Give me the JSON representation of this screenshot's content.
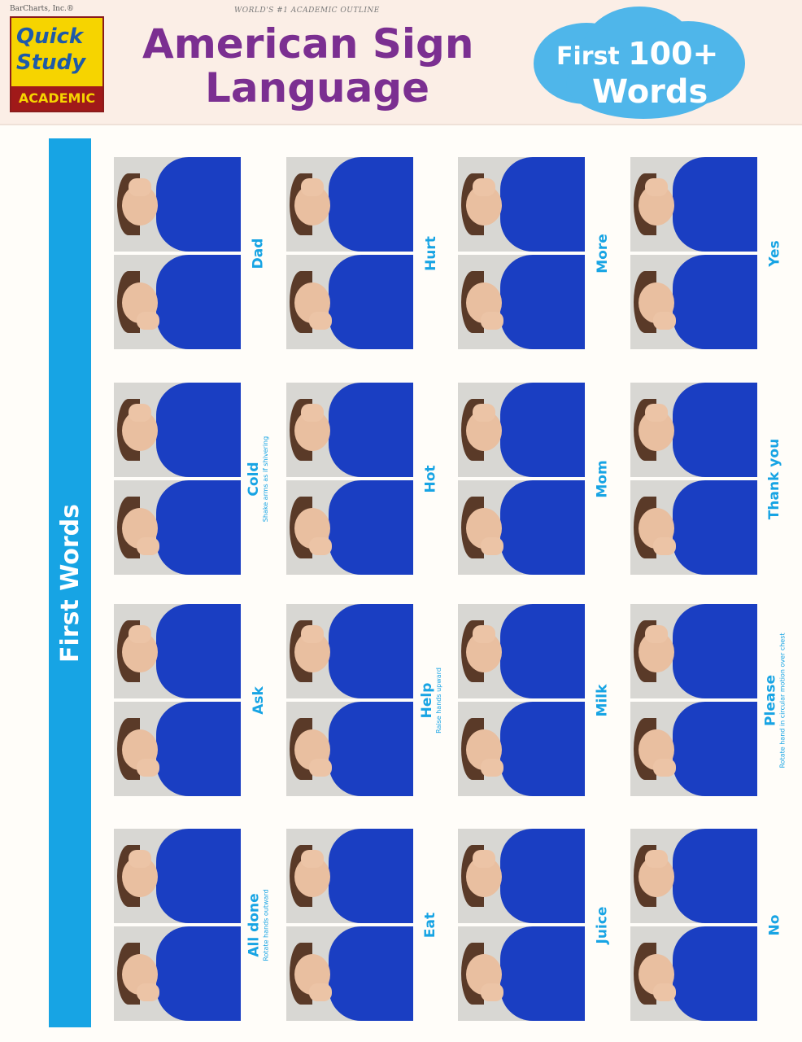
{
  "header": {
    "publisher": "BarCharts, Inc.®",
    "logo": {
      "line1": "Quick",
      "line2": "Study",
      "line3": "ACADEMIC"
    },
    "tagline": "WORLD'S #1 ACADEMIC OUTLINE",
    "title_line1": "American Sign",
    "title_line2": "Language",
    "badge": {
      "first": "First",
      "number": "100+",
      "words": "Words"
    }
  },
  "section_label": "First Words",
  "colors": {
    "accent": "#17a4e4",
    "title": "#7b2f91",
    "badge": "#4fb6ea",
    "shirt": "#1a3ec2"
  },
  "cards": [
    {
      "word": "Dad",
      "note": ""
    },
    {
      "word": "Hurt",
      "note": ""
    },
    {
      "word": "More",
      "note": ""
    },
    {
      "word": "Yes",
      "note": ""
    },
    {
      "word": "Cold",
      "note": "Shake arms as if shivering"
    },
    {
      "word": "Hot",
      "note": ""
    },
    {
      "word": "Mom",
      "note": ""
    },
    {
      "word": "Thank you",
      "note": ""
    },
    {
      "word": "Ask",
      "note": ""
    },
    {
      "word": "Help",
      "note": "Raise hands upward"
    },
    {
      "word": "Milk",
      "note": ""
    },
    {
      "word": "Please",
      "note": "Rotate hand in circular motion over chest"
    },
    {
      "word": "All done",
      "note": "Rotate hands outward"
    },
    {
      "word": "Eat",
      "note": ""
    },
    {
      "word": "Juice",
      "note": ""
    },
    {
      "word": "No",
      "note": ""
    }
  ]
}
